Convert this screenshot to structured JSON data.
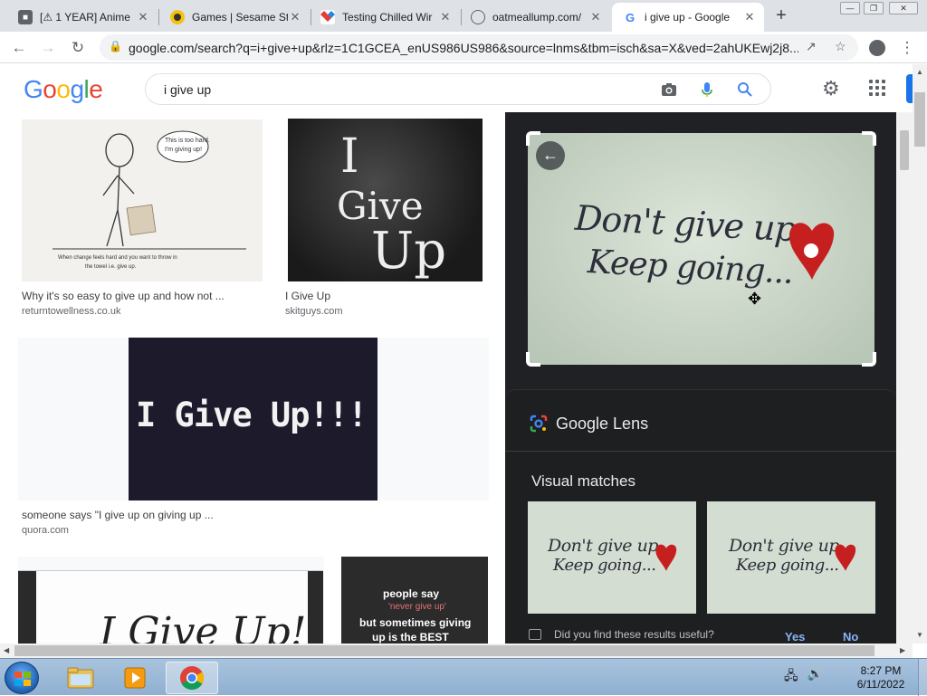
{
  "browser": {
    "tabs": [
      {
        "title": "[⚠ 1 YEAR] Anime",
        "favicon": "ghost-icon"
      },
      {
        "title": "Games | Sesame Str",
        "favicon": "sesame-icon"
      },
      {
        "title": "Testing Chilled Wir",
        "favicon": "dropbox-icon"
      },
      {
        "title": "oatmeallump.com/",
        "favicon": "globe-icon"
      },
      {
        "title": "i give up - Google",
        "favicon": "google-icon"
      }
    ],
    "url": "google.com/search?q=i+give+up&rlz=1C1GCEA_enUS986US986&source=lnms&tbm=isch&sa=X&ved=2ahUKEwj2j8..."
  },
  "google": {
    "logo_letters": [
      "G",
      "o",
      "o",
      "g",
      "l",
      "e"
    ],
    "logo_colors": [
      "#4285f4",
      "#ea4335",
      "#fbbc05",
      "#4285f4",
      "#34a853",
      "#ea4335"
    ],
    "query": "i give up"
  },
  "results": [
    {
      "caption": "Why it's so easy to give up and how not ...",
      "source": "returntowellness.co.uk",
      "thumb_texts": [
        "This is too hard.",
        "I'm giving up!",
        "When change feels hard and you want to throw in",
        "the towel i.e. give up."
      ]
    },
    {
      "caption": "I Give Up",
      "source": "skitguys.com",
      "thumb_texts": [
        "I",
        "Give",
        "Up"
      ]
    },
    {
      "caption": "someone says \"I give up on giving up ...",
      "source": "quora.com",
      "thumb_texts": [
        "I Give Up!!!"
      ]
    },
    {
      "caption": "",
      "source": "",
      "thumb_texts": [
        "I Give Up!"
      ]
    },
    {
      "caption": "",
      "source": "",
      "thumb_texts": [
        "people say",
        "'never give up'",
        "but sometimes giving",
        "up is the BEST"
      ]
    }
  ],
  "panel": {
    "image_line1": "Don't give up",
    "image_line2": "Keep going...",
    "lens_title": "Google Lens",
    "visual_matches_title": "Visual matches",
    "feedback_question": "Did you find these results useful?",
    "yes_label": "Yes",
    "no_label": "No"
  },
  "taskbar": {
    "time": "8:27 PM",
    "date": "6/11/2022"
  }
}
